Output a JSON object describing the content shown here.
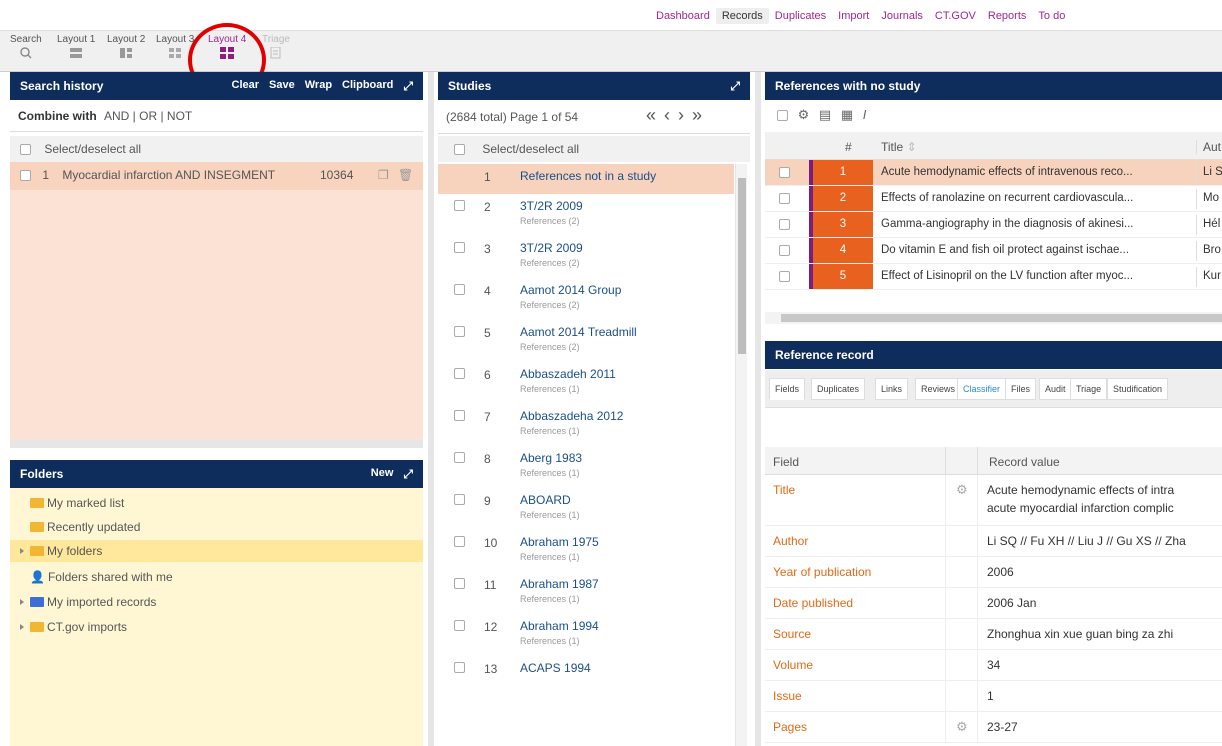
{
  "nav": {
    "links": [
      "Dashboard",
      "Records",
      "Duplicates",
      "Import",
      "Journals",
      "CT.GOV",
      "Reports",
      "To do"
    ],
    "active": "Records"
  },
  "toolbar": {
    "tools": [
      "Search",
      "Layout 1",
      "Layout 2",
      "Layout 3",
      "Layout 4",
      "Triage"
    ],
    "active": "Layout 4"
  },
  "search_history": {
    "title": "Search history",
    "actions": [
      "Clear",
      "Save",
      "Wrap",
      "Clipboard"
    ],
    "combine_label": "Combine with",
    "combine_ops": "AND | OR | NOT",
    "select_all": "Select/deselect all",
    "items": [
      {
        "num": "1",
        "query": "Myocardial infarction AND INSEGMENT",
        "count": "10364"
      }
    ]
  },
  "folders": {
    "title": "Folders",
    "new_label": "New",
    "items": [
      {
        "label": "My marked list",
        "icon": "folder-icon",
        "expandable": false
      },
      {
        "label": "Recently updated",
        "icon": "folder-icon",
        "expandable": false
      },
      {
        "label": "My folders",
        "icon": "folder-icon",
        "expandable": true
      },
      {
        "label": "Folders shared with me",
        "icon": "user-icon",
        "expandable": false
      },
      {
        "label": "My imported records",
        "icon": "folder-blue-icon",
        "expandable": true
      },
      {
        "label": "CT.gov imports",
        "icon": "folder-icon",
        "expandable": true
      }
    ]
  },
  "studies": {
    "title": "Studies",
    "paging": "(2684 total) Page 1 of 54",
    "pager_icons": [
      "«",
      "‹",
      "›",
      "»"
    ],
    "select_all": "Select/deselect all",
    "items": [
      {
        "num": "1",
        "title": "References not in a study",
        "sub": ""
      },
      {
        "num": "2",
        "title": "3T/2R 2009",
        "sub": "References (2)"
      },
      {
        "num": "3",
        "title": "3T/2R 2009",
        "sub": "References (2)"
      },
      {
        "num": "4",
        "title": "Aamot 2014 Group",
        "sub": "References (2)"
      },
      {
        "num": "5",
        "title": "Aamot 2014 Treadmill",
        "sub": "References (2)"
      },
      {
        "num": "6",
        "title": "Abbaszadeh 2011",
        "sub": "References (1)"
      },
      {
        "num": "7",
        "title": "Abbaszadeha 2012",
        "sub": "References (1)"
      },
      {
        "num": "8",
        "title": "Aberg 1983",
        "sub": "References (1)"
      },
      {
        "num": "9",
        "title": "ABOARD",
        "sub": "References (1)"
      },
      {
        "num": "10",
        "title": "Abraham 1975",
        "sub": "References (1)"
      },
      {
        "num": "11",
        "title": "Abraham 1987",
        "sub": "References (1)"
      },
      {
        "num": "12",
        "title": "Abraham 1994",
        "sub": "References (1)"
      },
      {
        "num": "13",
        "title": "ACAPS 1994",
        "sub": ""
      }
    ]
  },
  "refs": {
    "title": "References with no study",
    "col_num": "#",
    "col_title": "Title",
    "col_author": "Aut",
    "rows": [
      {
        "num": "1",
        "title": "Acute hemodynamic effects of intravenous reco...",
        "author": "Li S"
      },
      {
        "num": "2",
        "title": "Effects of ranolazine on recurrent cardiovascula...",
        "author": "Mo"
      },
      {
        "num": "3",
        "title": "Gamma-angiography in the diagnosis of akinesi...",
        "author": "Hél"
      },
      {
        "num": "4",
        "title": "Do vitamin E and fish oil protect against ischae...",
        "author": "Bro"
      },
      {
        "num": "5",
        "title": "Effect of Lisinopril on the LV function after myoc...",
        "author": "Kur"
      }
    ]
  },
  "record": {
    "title": "Reference record",
    "tabs": [
      "Fields",
      "Duplicates",
      "Links",
      "Reviews",
      "Classifier",
      "Files",
      "Audit",
      "Triage",
      "Studification"
    ],
    "col_field": "Field",
    "col_value": "Record value",
    "rows": [
      {
        "field": "Title",
        "value": "Acute hemodynamic effects of intra",
        "value2": "acute myocardial infarction complic",
        "gear": true
      },
      {
        "field": "Author",
        "value": "Li SQ // Fu XH // Liu J // Gu XS // Zha",
        "gear": false
      },
      {
        "field": "Year of publication",
        "value": "2006",
        "gear": false
      },
      {
        "field": "Date published",
        "value": "2006 Jan",
        "gear": false
      },
      {
        "field": "Source",
        "value": "Zhonghua xin xue guan bing za zhi",
        "gear": false
      },
      {
        "field": "Volume",
        "value": "34",
        "gear": false
      },
      {
        "field": "Issue",
        "value": "1",
        "gear": false
      },
      {
        "field": "Pages",
        "value": "23-27",
        "gear": true
      }
    ]
  },
  "colors": {
    "header": "#0f2d5c",
    "accent": "#a0278f",
    "orange": "#e8611f",
    "highlight": "#e00000"
  }
}
